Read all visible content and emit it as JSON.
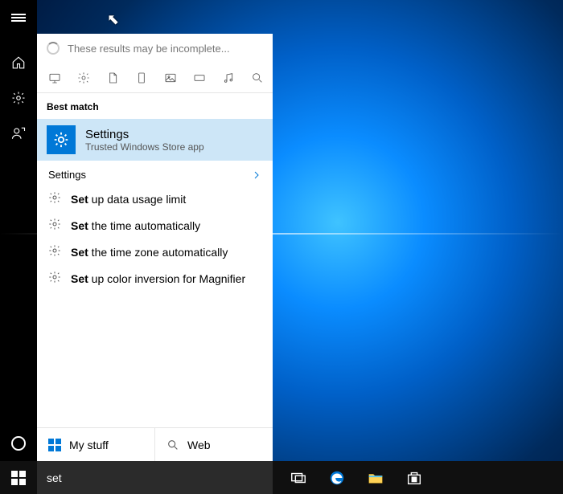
{
  "loading_text": "These results may be incomplete...",
  "best_match_label": "Best match",
  "best_match": {
    "title": "Settings",
    "subtitle": "Trusted Windows Store app"
  },
  "settings_group_label": "Settings",
  "results": [
    {
      "bold": "Set",
      "rest": " up data usage limit"
    },
    {
      "bold": "Set",
      "rest": " the time automatically"
    },
    {
      "bold": "Set",
      "rest": " the time zone automatically"
    },
    {
      "bold": "Set",
      "rest": " up color inversion for Magnifier"
    }
  ],
  "scope": {
    "mystuff": "My stuff",
    "web": "Web"
  },
  "search_query": "set"
}
